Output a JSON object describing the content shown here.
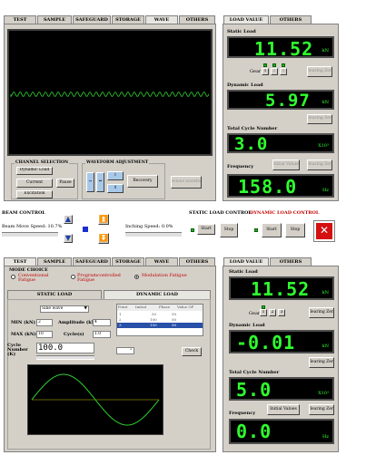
{
  "top": {
    "tabs": [
      "TEST",
      "SAMPLE",
      "SAFEGUARD",
      "STORAGE",
      "WAVE",
      "OTHERS"
    ],
    "active_tab": "WAVE",
    "load_tabs": [
      "LOAD VALUE",
      "OTHERS"
    ],
    "channel_selection": {
      "title": "CHANNEL SELECTION",
      "buttons": [
        "Dynamic Load",
        "Current",
        "Excitation"
      ],
      "pause": "Pause"
    },
    "waveform_adjustment": {
      "title": "WAVEFORM ADJUSTMENT",
      "recovery": "Recovery",
      "previous": "Previous waveform"
    },
    "static_load": {
      "label": "Static Load",
      "value": "11.52",
      "unit": "kN"
    },
    "gear": {
      "label": "Gear",
      "options": [
        "1",
        "2",
        "3"
      ]
    },
    "clearing_zero": "Clearing Zero",
    "dynamic_load": {
      "label": "Dynamic Load",
      "value": "5.97",
      "unit": "kN"
    },
    "total_cycle": {
      "label": "Total Cycle Number",
      "value": "3.0",
      "unit": "X10³"
    },
    "frequency": {
      "label": "Frequency",
      "value": "158.0",
      "unit": "Hz"
    },
    "initial_values": "Initial Values"
  },
  "control_bar": {
    "beam_control": "BEAM CONTROL",
    "beam_speed": "Beam Move Speed: 10.7%",
    "inching_speed": "Inching Speed: 0.0%",
    "static_load_control": "STATIC LOAD CONTROL",
    "dynamic_load_control": "DYNAMIC LOAD CONTROL",
    "start": "Start",
    "stop": "Stop"
  },
  "bottom": {
    "tabs": [
      "TEST",
      "SAMPLE",
      "SAFEGUARD",
      "STORAGE",
      "WAVE",
      "OTHERS"
    ],
    "active_tab": "TEST",
    "load_tabs": [
      "LOAD VALUE",
      "OTHERS"
    ],
    "mode_choice": {
      "title": "MODE CHOICE",
      "options": [
        "Conventional Fatigue",
        "Programcontrolled Fatigue",
        "Modulation Fatigue"
      ]
    },
    "sub_tabs": [
      "STATIC LOAD",
      "DYNAMIC LOAD"
    ],
    "wave_type": "Sine wave",
    "table_headers": [
      "Point",
      "Initial",
      "Phase",
      "Value OF"
    ],
    "table_rows": [
      [
        "1",
        "50",
        "50"
      ],
      [
        "2",
        "100",
        "50"
      ],
      [
        "3",
        "150",
        "50"
      ]
    ],
    "min_label": "MIN (kN)",
    "min_value": "2",
    "max_label": "MAX (kN)",
    "max_value": "10",
    "amplitude_label": "Amplitude (kN)",
    "amplitude_value": "4",
    "cycle_s_label": "Cycle(s)",
    "cycle_s_value": "1.0",
    "cycle_number_label": "Cycle Number (K)",
    "cycle_number_value": "100.0",
    "check": "Check",
    "static_load": {
      "label": "Static Load",
      "value": "11.52",
      "unit": "kN"
    },
    "gear": {
      "label": "Gear",
      "options": [
        "1",
        "2",
        "3"
      ]
    },
    "clearing_zero": "Clearing Zero",
    "dynamic_load": {
      "label": "Dynamic Load",
      "value": "-0.01",
      "unit": "kN"
    },
    "total_cycle": {
      "label": "Total Cycle Number",
      "value": "5.0",
      "unit": "X10³"
    },
    "frequency": {
      "label": "Frequency",
      "value": "0.0",
      "unit": "Hz"
    },
    "initial_values": "Initial Values"
  },
  "colors": {
    "lcd_text": "#2fff2f",
    "panel": "#d4d0c8",
    "scope_bg": "#000000",
    "wave": "#2fd02f"
  }
}
